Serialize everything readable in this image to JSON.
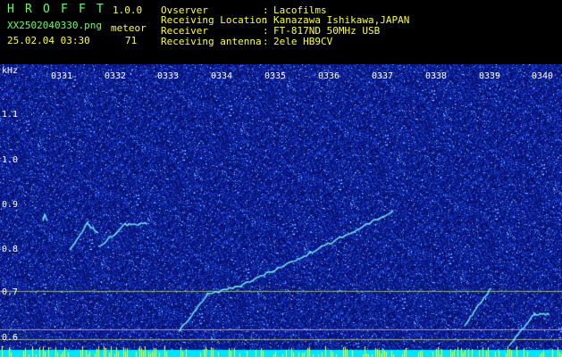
{
  "app": {
    "name_letters": [
      "H",
      "R",
      "O",
      "F",
      "F",
      "T"
    ],
    "version": "1.0.0",
    "meteor_label": "meteor",
    "meteor_count": "71",
    "filename": "XX2502040330.png",
    "datetime": "25.02.04 03:30"
  },
  "info": {
    "rows": [
      {
        "label": "Ovserver",
        "sep": ":",
        "value": "Lacofilms"
      },
      {
        "label": "Receiving Location",
        "sep": ":",
        "value": "Kanazawa Ishikawa,JAPAN"
      },
      {
        "label": "Receiver",
        "sep": ":",
        "value": "FT-817ND 50MHz USB"
      },
      {
        "label": "Receiving antenna",
        "sep": ":",
        "value": "2ele HB9CV"
      }
    ]
  },
  "spectrogram": {
    "y_unit": "kHz",
    "y_ticks": [
      "1.1",
      "1.0",
      "0.9",
      "0.8",
      "0.7",
      "0.6"
    ],
    "time_ticks": [
      "0331",
      "0332",
      "0333",
      "0334",
      "0335",
      "0336",
      "0337",
      "0338",
      "0339",
      "0340"
    ],
    "background_color": "#0a1a8c",
    "noise_color": "#2f6bff",
    "trace_color": "#7fffff",
    "reference_line_color": "#d8e070",
    "activity_bar_colors": [
      "#00e5ff",
      "#ffff00"
    ]
  }
}
